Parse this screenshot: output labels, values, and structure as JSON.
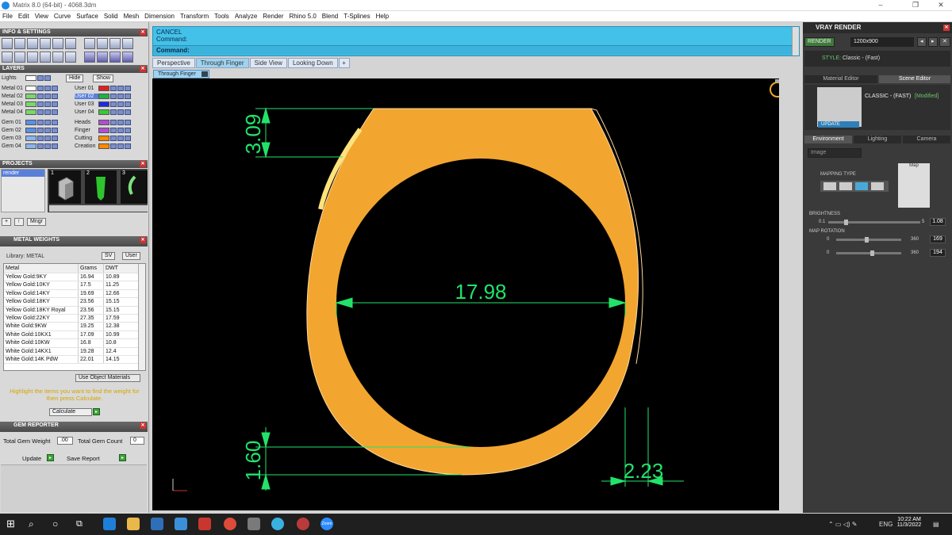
{
  "window": {
    "title": "Matrix 8.0 (64-bit) - 4068.3dm",
    "min": "–",
    "max": "❐",
    "close": "✕"
  },
  "menu": [
    "File",
    "Edit",
    "View",
    "Curve",
    "Surface",
    "Solid",
    "Mesh",
    "Dimension",
    "Transform",
    "Tools",
    "Analyze",
    "Render",
    "Rhino 5.0",
    "Blend",
    "T-Splines",
    "Help"
  ],
  "left": {
    "info_title": "INFO & SETTINGS",
    "layers_title": "LAYERS",
    "layers_header": {
      "name": "Lights",
      "hide": "Hide",
      "show": "Show"
    },
    "layers_left": [
      {
        "name": "Metal 01",
        "color": "#ffffff"
      },
      {
        "name": "Metal 02",
        "color": "#7cd66e"
      },
      {
        "name": "Metal 03",
        "color": "#7cd66e"
      },
      {
        "name": "Metal 04",
        "color": "#7cd66e"
      },
      {
        "name": "Gem 01",
        "color": "#5a8fe8"
      },
      {
        "name": "Gem 02",
        "color": "#5a8fe8"
      },
      {
        "name": "Gem 03",
        "color": "#8ab4f0"
      },
      {
        "name": "Gem 04",
        "color": "#8ab4f0"
      }
    ],
    "layers_right": [
      {
        "name": "User 01",
        "color": "#e02020"
      },
      {
        "name": "User 02",
        "color": "#1fb04a"
      },
      {
        "name": "User 03",
        "color": "#1a2be0"
      },
      {
        "name": "User 04",
        "color": "#38c838"
      },
      {
        "name": "Heads",
        "color": "#b04fd0"
      },
      {
        "name": "Finger",
        "color": "#b04fd0"
      },
      {
        "name": "Cutting",
        "color": "#ff8800"
      },
      {
        "name": "Creation",
        "color": "#ff8800"
      }
    ],
    "projects_title": "PROJECTS",
    "projects_item": "render",
    "project_nums": [
      "1",
      "2",
      "3"
    ],
    "projects_btns": {
      "add": "+",
      "up": "↑",
      "mngr": "Mngr"
    },
    "metal_title": "METAL WEIGHTS",
    "library_label": "Library: METAL",
    "lib_btns": {
      "sv": "SV",
      "user": "User"
    },
    "table_headers": [
      "Metal",
      "Grams",
      "DWT"
    ],
    "table_rows": [
      [
        "Yellow Gold:9KY",
        "16.94",
        "10.89"
      ],
      [
        "Yellow Gold:10KY",
        "17.5",
        "11.25"
      ],
      [
        "Yellow Gold:14KY",
        "19.69",
        "12.66"
      ],
      [
        "Yellow Gold:18KY",
        "23.56",
        "15.15"
      ],
      [
        "Yellow Gold:18KY Royal",
        "23.56",
        "15.15"
      ],
      [
        "Yellow Gold:22KY",
        "27.35",
        "17.59"
      ],
      [
        "White Gold:9KW",
        "19.25",
        "12.38"
      ],
      [
        "White Gold:10KX1",
        "17.09",
        "10.99"
      ],
      [
        "White Gold:10KW",
        "16.8",
        "10.8"
      ],
      [
        "White Gold:14KX1",
        "19.28",
        "12.4"
      ],
      [
        "White Gold:14K PdW",
        "22.01",
        "14.15"
      ]
    ],
    "use_object_materials": "Use Object Materials",
    "highlight_text": "Highlight the items you want to find the weight for then press Calculate.",
    "calculate": "Calculate",
    "gem_title": "GEM REPORTER",
    "total_gem_weight": "Total Gem Weight",
    "total_gem_weight_val": ".00",
    "total_gem_count": "Total Gem Count",
    "total_gem_count_val": "0",
    "update": "Update",
    "save_report": "Save Report"
  },
  "command": {
    "line1": "CANCEL",
    "line2": "Command:",
    "prompt": "Command:"
  },
  "tabs": [
    {
      "label": "Perspective",
      "active": false
    },
    {
      "label": "Through Finger",
      "active": true
    },
    {
      "label": "Side View",
      "active": false
    },
    {
      "label": "Looking Down",
      "active": false
    },
    {
      "label": "+",
      "active": false
    }
  ],
  "viewport": {
    "label": "Through Finger",
    "dims": {
      "top": "3.09",
      "width": "17.98",
      "bottom": "1.60",
      "right": "2.23"
    },
    "colors": {
      "ring": "#f0a830",
      "dim": "#22e36a",
      "bg": "#000000"
    }
  },
  "right": {
    "title": "VRAY RENDER",
    "render_btn": "RENDER",
    "resolution": "1200x900",
    "style_label": "STYLE:",
    "style_value": "Classic - (Fast)",
    "tab_material": "Material Editor",
    "tab_scene": "Scene Editor",
    "preset_name": "CLASSIC - (FAST)",
    "preset_mod": "[Modified]",
    "update": "UPDATE",
    "env_tabs": [
      "Environment",
      "Lighting",
      "Camera"
    ],
    "image_dropdown": "Image",
    "mapping_type": "MAPPING TYPE",
    "map_label": "Map",
    "brightness": "BRIGHTNESS",
    "brightness_min": "0.1",
    "brightness_max": "5",
    "brightness_val": "1.08",
    "map_rotation": "MAP ROTATION",
    "rot1_min": "0",
    "rot1_max": "360",
    "rot1_val": "169",
    "rot2_min": "0",
    "rot2_max": "360",
    "rot2_val": "194"
  },
  "taskbar": {
    "time": "10:22 AM",
    "date": "11/3/2022",
    "lang": "ENG",
    "zoom_app": "Zoom"
  }
}
